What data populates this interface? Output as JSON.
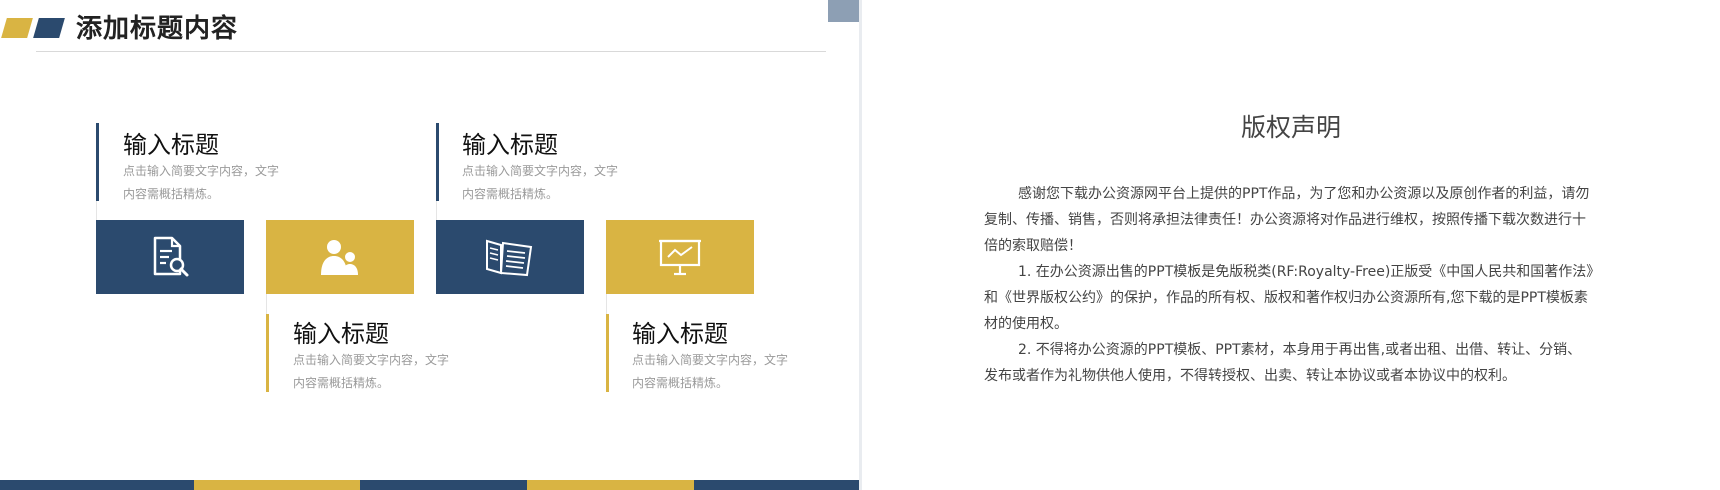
{
  "left_slide": {
    "title": "添加标题内容",
    "colors": {
      "navy": "#2b4a6e",
      "gold": "#d9b443",
      "corner": "#8d9fb4"
    },
    "items": [
      {
        "title": "输入标题",
        "desc_line1": "点击输入简要文字内容，文字",
        "desc_line2": "内容需概括精炼。",
        "icon": "document-search-icon",
        "color": "navy"
      },
      {
        "title": "输入标题",
        "desc_line1": "点击输入简要文字内容，文字",
        "desc_line2": "内容需概括精炼。",
        "icon": "people-icon",
        "color": "gold"
      },
      {
        "title": "输入标题",
        "desc_line1": "点击输入简要文字内容，文字",
        "desc_line2": "内容需概括精炼。",
        "icon": "newspaper-icon",
        "color": "navy"
      },
      {
        "title": "输入标题",
        "desc_line1": "点击输入简要文字内容，文字",
        "desc_line2": "内容需概括精炼。",
        "icon": "presentation-board-icon",
        "color": "gold"
      }
    ]
  },
  "right_slide": {
    "title": "版权声明",
    "paragraphs": [
      "感谢您下载办公资源网平台上提供的PPT作品，为了您和办公资源以及原创作者的利益，请勿复制、传播、销售，否则将承担法律责任！办公资源将对作品进行维权，按照传播下载次数进行十倍的索取赔偿！",
      "1. 在办公资源出售的PPT模板是免版税类(RF:Royalty-Free)正版受《中国人民共和国著作法》和《世界版权公约》的保护，作品的所有权、版权和著作权归办公资源所有,您下载的是PPT模板素材的使用权。",
      "2. 不得将办公资源的PPT模板、PPT素材，本身用于再出售,或者出租、出借、转让、分销、发布或者作为礼物供他人使用，不得转授权、出卖、转让本协议或者本协议中的权利。"
    ]
  }
}
